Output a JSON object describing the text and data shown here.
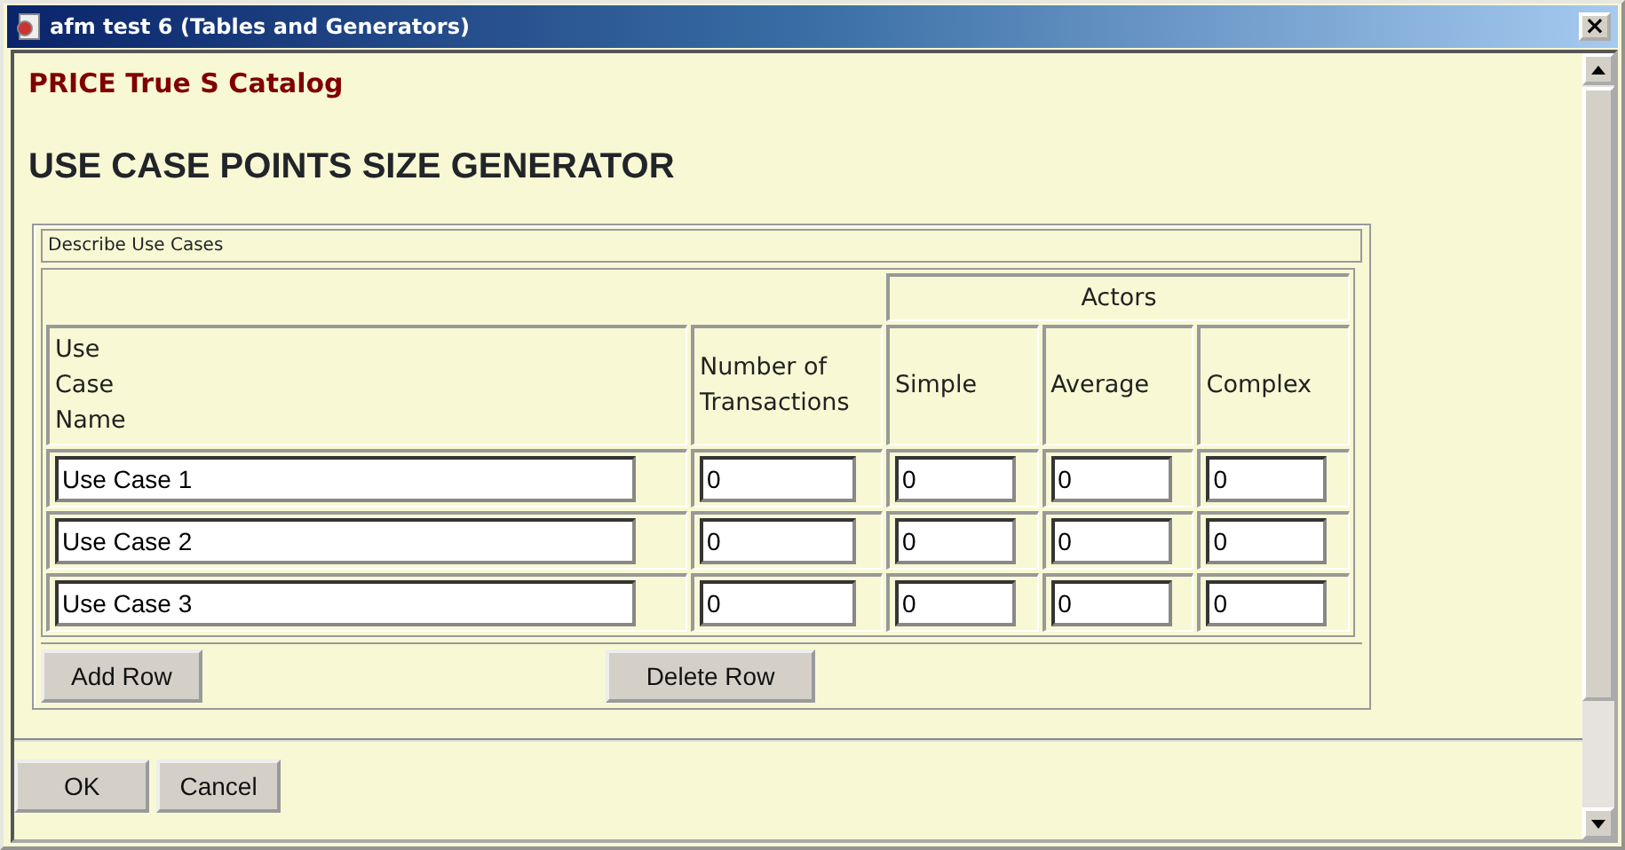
{
  "window": {
    "title": "afm test 6 (Tables and Generators)",
    "close": "×"
  },
  "catalog": "PRICE True S Catalog",
  "heading": "USE CASE POINTS SIZE GENERATOR",
  "panel": {
    "legend": "Describe Use Cases",
    "group_header": "Actors",
    "columns": [
      "Use\nCase\nName",
      "Number of\nTransactions",
      "Simple",
      "Average",
      "Complex"
    ],
    "rows": [
      {
        "name": "Use Case 1",
        "values": [
          "0",
          "0",
          "0",
          "0"
        ]
      },
      {
        "name": "Use Case 2",
        "values": [
          "0",
          "0",
          "0",
          "0"
        ]
      },
      {
        "name": "Use Case 3",
        "values": [
          "0",
          "0",
          "0",
          "0"
        ]
      }
    ],
    "buttons": [
      "Add Row",
      "Delete Row"
    ]
  },
  "footer_buttons": [
    "OK",
    "Cancel"
  ]
}
